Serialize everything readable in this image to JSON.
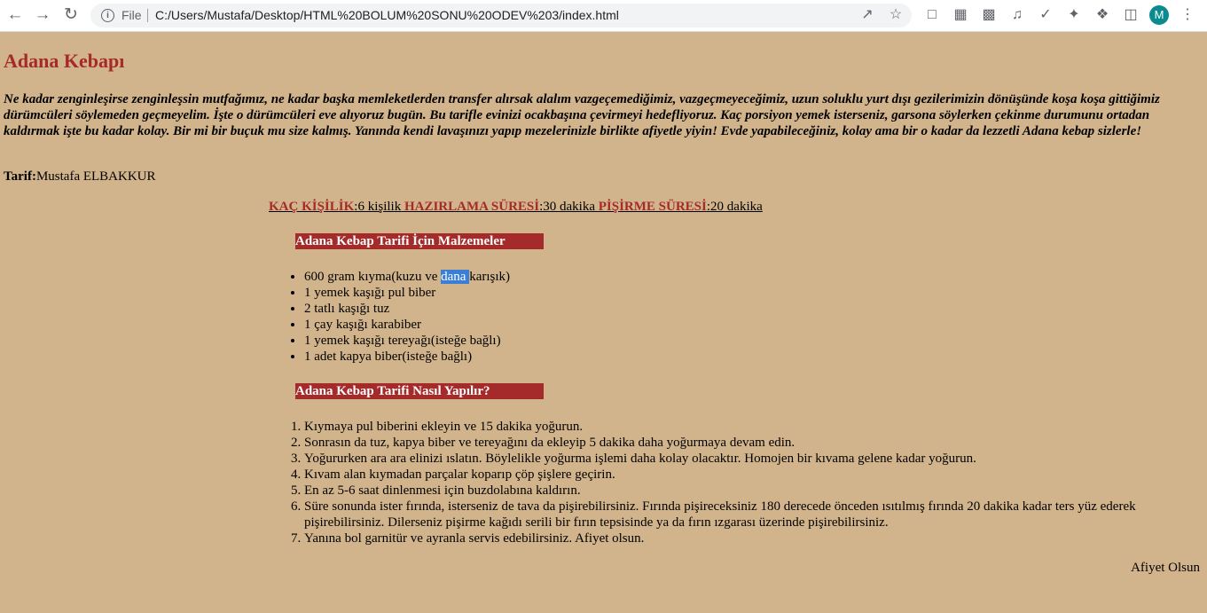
{
  "browser": {
    "file_label": "File",
    "url": "C:/Users/Mustafa/Desktop/HTML%20BOLUM%20SONU%20ODEV%203/index.html",
    "profile_initial": "M"
  },
  "page": {
    "title": "Adana Kebapı",
    "intro": "Ne kadar zenginleşirse zenginleşsin mutfağımız, ne kadar başka memleketlerden transfer alırsak alalım vazgeçemediğimiz, vazgeçmeyeceğimiz, uzun soluklu yurt dışı gezilerimizin dönüşünde koşa koşa gittiğimiz dürümcüleri söylemeden geçmeyelim. İşte o dürümcüleri eve alıyoruz bugün. Bu tarifle evinizi ocakbaşına çevirmeyi hedefliyoruz. Kaç porsiyon yemek isterseniz, garsona söylerken çekinme durumunu ortadan kaldırmak işte bu kadar kolay. Bir mi bir buçuk mu size kalmış. Yanında kendi lavaşınızı yapıp mezelerinizle birlikte afiyetle yiyin! Evde yapabileceğiniz, kolay ama bir o kadar da lezzetli Adana kebap sizlerle!",
    "tarif_label": "Tarif:",
    "tarif_author": "Mustafa ELBAKKUR",
    "meta": {
      "servings_label": "KAÇ KİŞİLİK",
      "servings_value": ":6 kişilik",
      "prep_label": "HAZIRLAMA SÜRESİ",
      "prep_value": ":30 dakika",
      "cook_label": "PİŞİRME SÜRESİ",
      "cook_value": ":20 dakika"
    },
    "ingredients_title": "Adana Kebap Tarifi İçin Malzemeler",
    "ingredients": [
      {
        "before": "600 gram kıyma(kuzu ve ",
        "selected": "dana ",
        "after": "karışık)"
      },
      {
        "before": "1 yemek kaşığı pul biber",
        "selected": "",
        "after": ""
      },
      {
        "before": "2 tatlı kaşığı tuz",
        "selected": "",
        "after": ""
      },
      {
        "before": "1 çay kaşığı karabiber",
        "selected": "",
        "after": ""
      },
      {
        "before": "1 yemek kaşığı tereyağı(isteğe bağlı)",
        "selected": "",
        "after": ""
      },
      {
        "before": "1 adet kapya biber(isteğe bağlı)",
        "selected": "",
        "after": ""
      }
    ],
    "steps_title": "Adana Kebap Tarifi Nasıl Yapılır?",
    "steps": [
      "Kıymaya pul biberini ekleyin ve 15 dakika yoğurun.",
      "Sonrasın da tuz, kapya biber ve tereyağını da ekleyip 5 dakika daha yoğurmaya devam edin.",
      "Yoğururken ara ara elinizi ıslatın. Böylelikle yoğurma işlemi daha kolay olacaktır. Homojen bir kıvama gelene kadar yoğurun.",
      "Kıvam alan kıymadan parçalar koparıp çöp şişlere geçirin.",
      "En az 5-6 saat dinlenmesi için buzdolabına kaldırın.",
      "Süre sonunda ister fırında, isterseniz de tava da pişirebilirsiniz. Fırında pişireceksiniz 180 derecede önceden ısıtılmış fırında 20 dakika kadar ters yüz ederek pişirebilirsiniz. Dilerseniz pişirme kağıdı serili bir fırın tepsisinde ya da fırın ızgarası üzerinde pişirebilirsiniz.",
      "Yanına bol garnitür ve ayranla servis edebilirsiniz. Afiyet olsun."
    ],
    "footer": "Afiyet Olsun"
  },
  "colors": {
    "page_bg": "#d2b48c",
    "accent": "#a52a2a",
    "selection": "#3a7fd5"
  }
}
